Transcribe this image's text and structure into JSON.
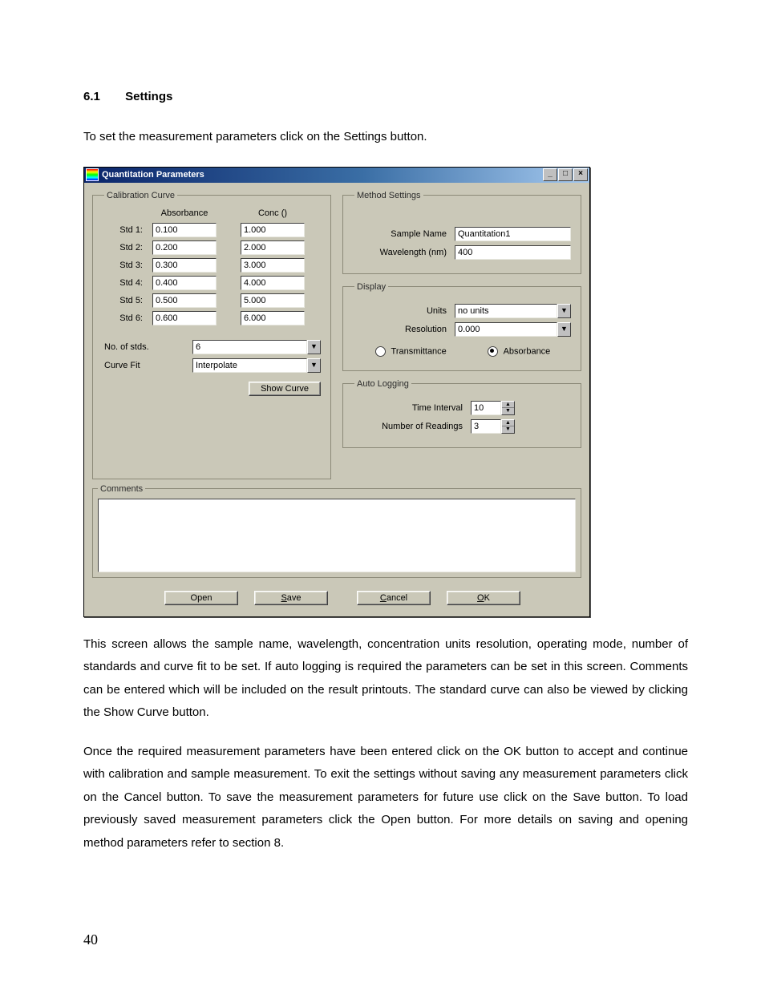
{
  "doc": {
    "heading_num": "6.1",
    "heading_title": "Settings",
    "intro": "To set the measurement parameters click on the Settings button.",
    "para1": "This screen allows the sample name, wavelength, concentration units resolution, operating mode, number of standards and curve fit to be set. If auto logging is required the parameters can be set in this screen. Comments can be entered which will be included on the result printouts. The standard curve can also be viewed by clicking the Show Curve button.",
    "para2": "Once the required measurement parameters have been entered click on the OK button to accept and continue with calibration and sample measurement. To exit the settings without saving any measurement parameters click on the Cancel button. To save the measurement parameters for future use click on the Save button. To load previously saved measurement parameters click the Open button.  For more details on saving and opening method parameters refer to section 8.",
    "page_number": "40"
  },
  "window": {
    "title": "Quantitation Parameters",
    "groups": {
      "calibration": {
        "legend": "Calibration Curve",
        "col_abs": "Absorbance",
        "col_conc": "Conc ()",
        "rows": [
          {
            "label": "Std 1:",
            "abs": "0.100",
            "conc": "1.000"
          },
          {
            "label": "Std 2:",
            "abs": "0.200",
            "conc": "2.000"
          },
          {
            "label": "Std 3:",
            "abs": "0.300",
            "conc": "3.000"
          },
          {
            "label": "Std 4:",
            "abs": "0.400",
            "conc": "4.000"
          },
          {
            "label": "Std 5:",
            "abs": "0.500",
            "conc": "5.000"
          },
          {
            "label": "Std 6:",
            "abs": "0.600",
            "conc": "6.000"
          }
        ],
        "no_of_stds_label": "No. of stds.",
        "no_of_stds_value": "6",
        "curve_fit_label": "Curve Fit",
        "curve_fit_value": "Interpolate",
        "show_curve_btn": "Show Curve"
      },
      "method": {
        "legend": "Method Settings",
        "sample_name_label": "Sample Name",
        "sample_name_value": "Quantitation1",
        "wavelength_label": "Wavelength (nm)",
        "wavelength_value": "400"
      },
      "display": {
        "legend": "Display",
        "units_label": "Units",
        "units_value": "no units",
        "resolution_label": "Resolution",
        "resolution_value": "0.000",
        "radio_transmittance": "Transmittance",
        "radio_absorbance": "Absorbance"
      },
      "autolog": {
        "legend": "Auto Logging",
        "time_interval_label": "Time Interval",
        "time_interval_value": "10",
        "num_readings_label": "Number of Readings",
        "num_readings_value": "3"
      },
      "comments": {
        "legend": "Comments"
      }
    },
    "buttons": {
      "open": "Open",
      "save": "Save",
      "cancel": "Cancel",
      "ok": "OK"
    }
  }
}
